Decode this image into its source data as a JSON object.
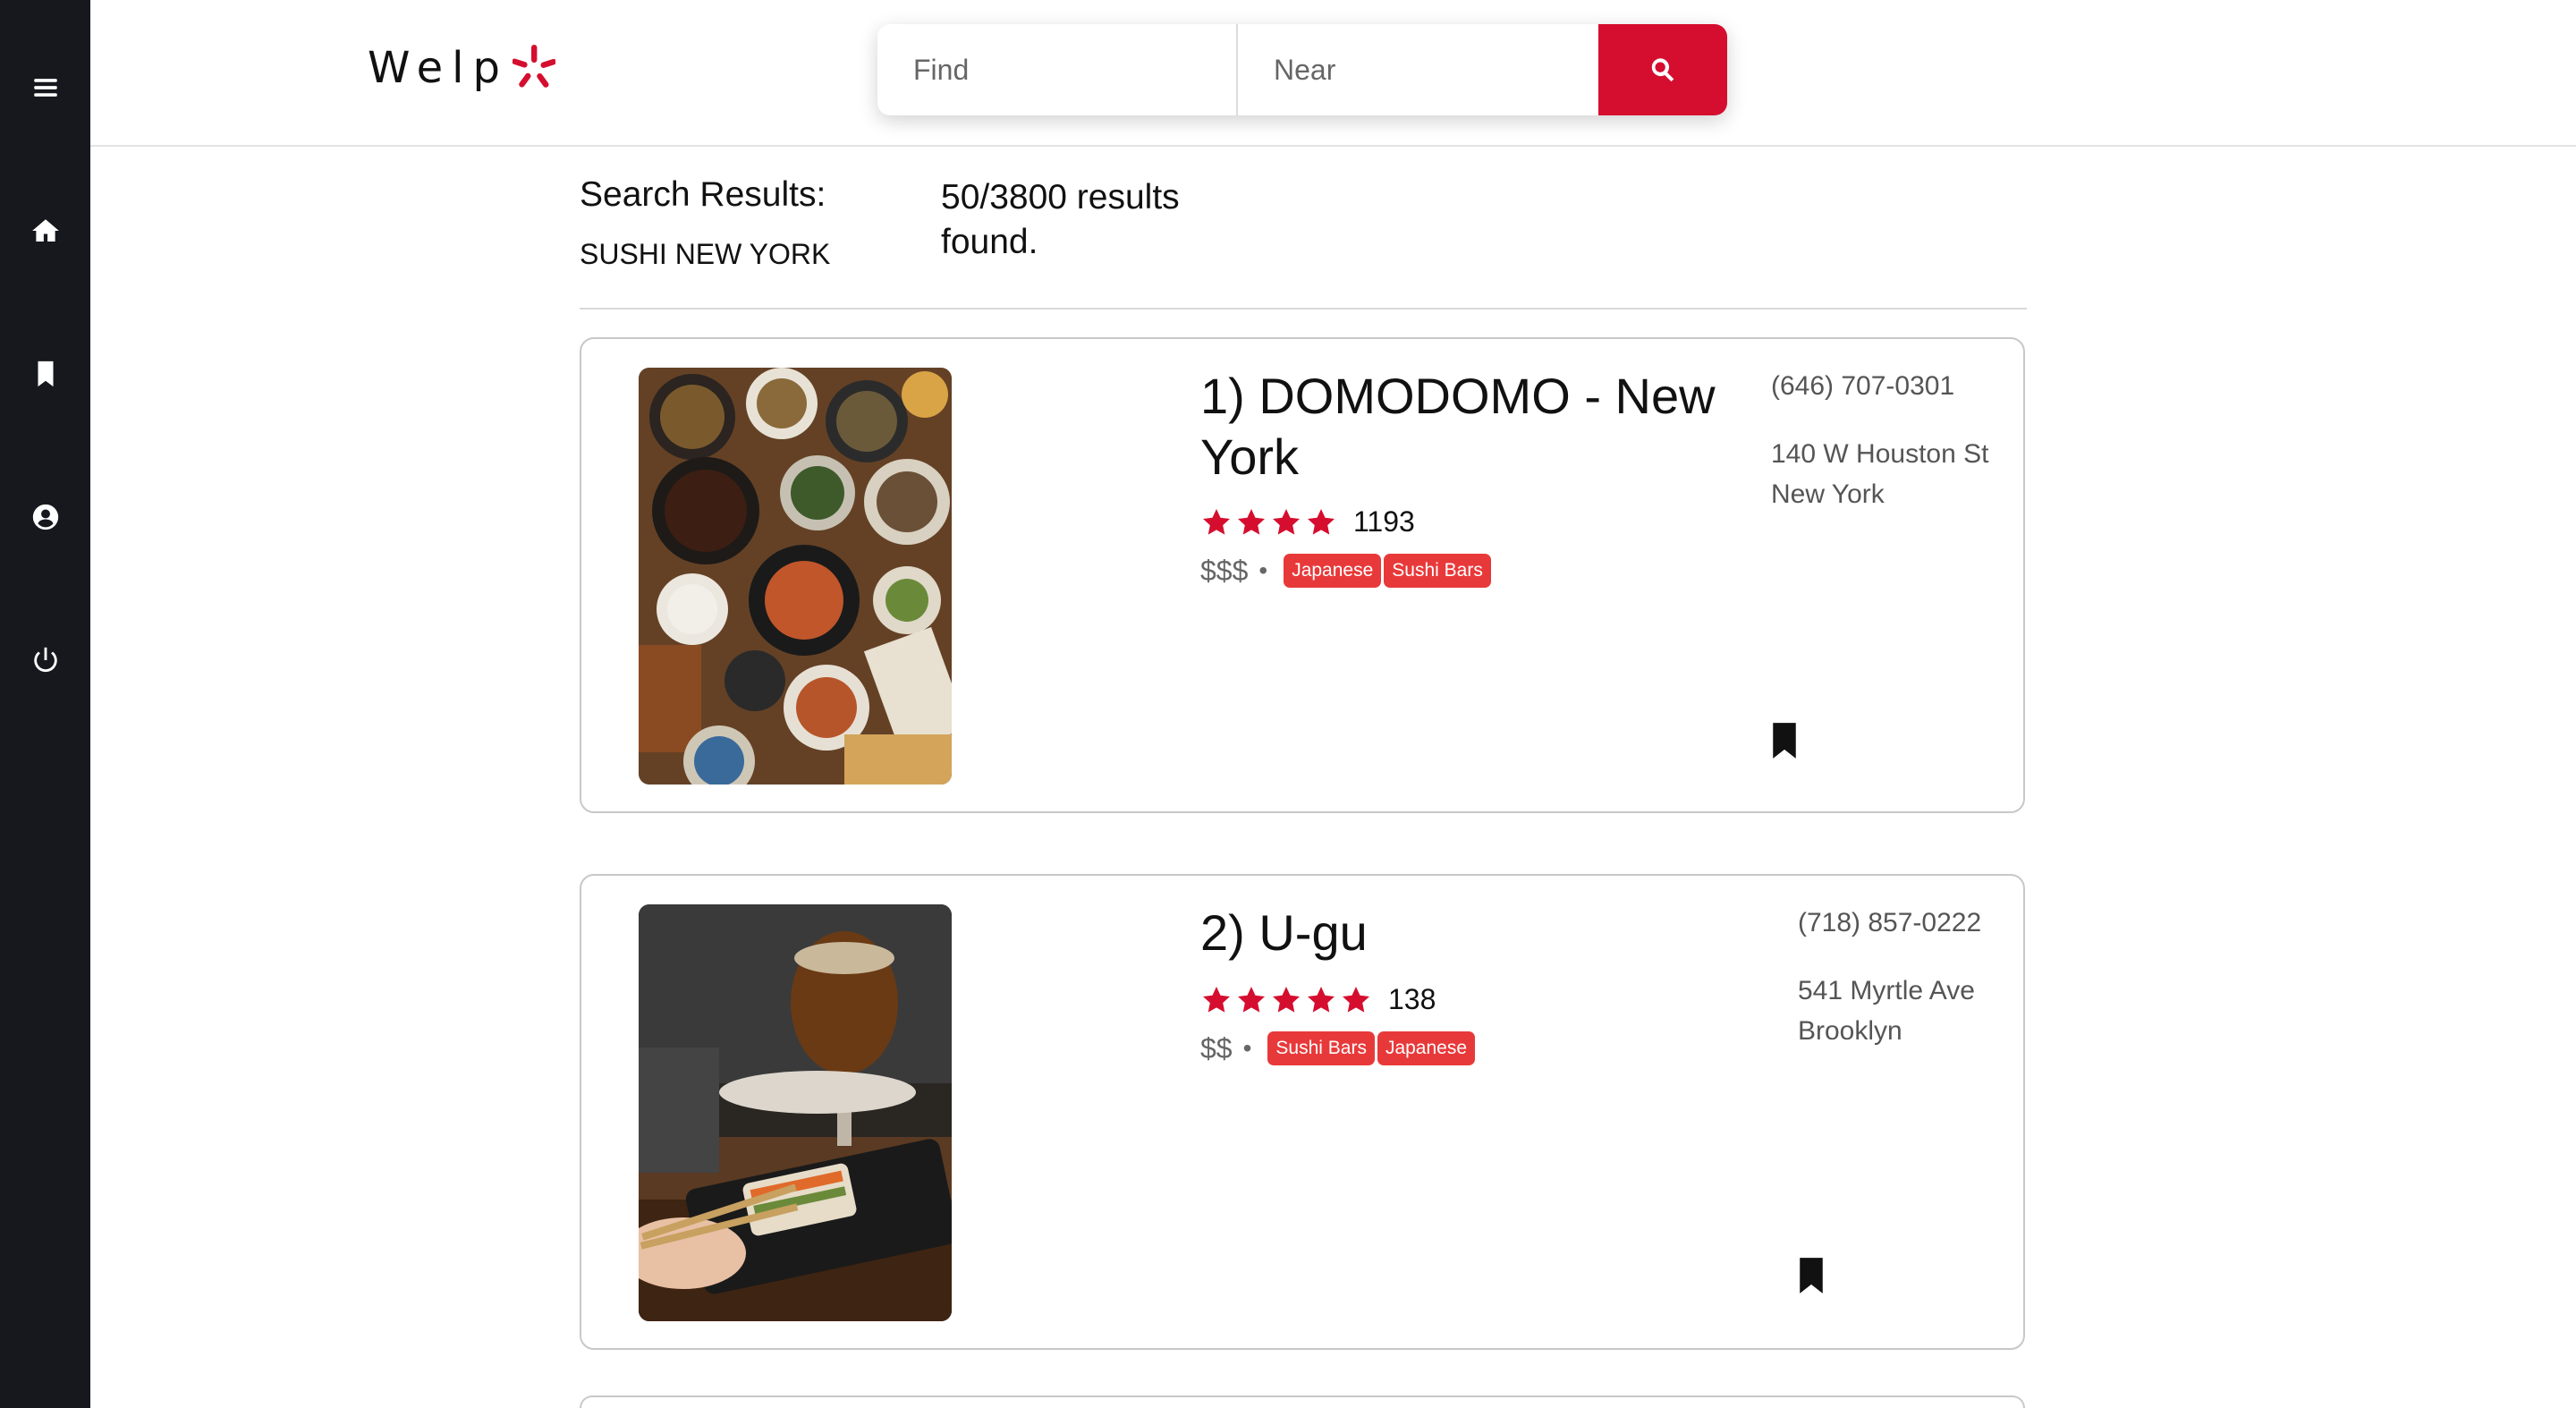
{
  "app": {
    "logo_text": "Welp"
  },
  "sidebar": {
    "items": [
      {
        "icon": "menu-icon"
      },
      {
        "icon": "home-icon"
      },
      {
        "icon": "bookmark-icon"
      },
      {
        "icon": "user-circle-icon"
      },
      {
        "icon": "power-icon"
      }
    ]
  },
  "search": {
    "find_placeholder": "Find",
    "near_placeholder": "Near",
    "find_value": "",
    "near_value": "",
    "button_icon": "search-icon"
  },
  "results": {
    "label": "Search Results:",
    "query": "SUSHI NEW YORK",
    "count_text": "50/3800 results found."
  },
  "listings": [
    {
      "title": "1) DOMODOMO - New York",
      "rating": 4,
      "review_count": "1193",
      "price": "$$$",
      "separator": "•",
      "tags": [
        "Japanese",
        "Sushi Bars"
      ],
      "phone": "(646) 707-0301",
      "address_line1": "140 W Houston St",
      "address_line2": "New York"
    },
    {
      "title": "2) U-gu",
      "rating": 5,
      "review_count": "138",
      "price": "$$",
      "separator": "•",
      "tags": [
        "Sushi Bars",
        "Japanese"
      ],
      "phone": "(718) 857-0222",
      "address_line1": "541 Myrtle Ave",
      "address_line2": "Brooklyn"
    }
  ],
  "colors": {
    "brand_red": "#d50e2f",
    "tag_red": "#e8393a",
    "sidebar_bg": "#16181d"
  }
}
